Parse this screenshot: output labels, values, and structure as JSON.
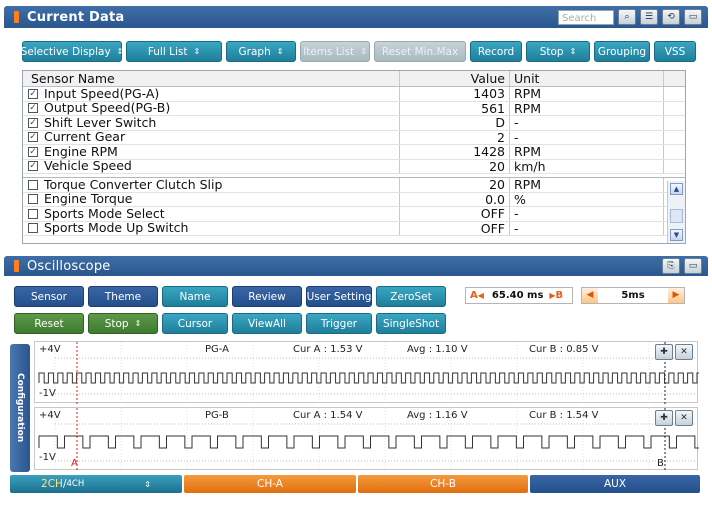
{
  "current_data": {
    "title": "Current Data",
    "search_placeholder": "Search",
    "header_icons": [
      "search-list-icon",
      "list-icon",
      "retrieve-icon",
      "window-icon"
    ],
    "toolbar": [
      {
        "label": "Selective Display",
        "dropdown": true,
        "disabled": false
      },
      {
        "label": "Full List",
        "dropdown": true,
        "disabled": false
      },
      {
        "label": "Graph",
        "dropdown": true,
        "disabled": false
      },
      {
        "label": "Items List",
        "dropdown": true,
        "disabled": true
      },
      {
        "label": "Reset Min.Max",
        "dropdown": false,
        "disabled": true
      },
      {
        "label": "Record",
        "dropdown": false,
        "disabled": false
      },
      {
        "label": "Stop",
        "dropdown": true,
        "disabled": false
      },
      {
        "label": "Grouping",
        "dropdown": false,
        "disabled": false
      },
      {
        "label": "VSS",
        "dropdown": false,
        "disabled": false
      }
    ],
    "table": {
      "headers": {
        "name": "Sensor Name",
        "value": "Value",
        "unit": "Unit"
      },
      "selected_rows": [
        {
          "name": "Input Speed(PG-A)",
          "value": "1403",
          "unit": "RPM"
        },
        {
          "name": "Output Speed(PG-B)",
          "value": "561",
          "unit": "RPM"
        },
        {
          "name": "Shift Lever Switch",
          "value": "D",
          "unit": "-"
        },
        {
          "name": "Current Gear",
          "value": "2",
          "unit": "-"
        },
        {
          "name": "Engine RPM",
          "value": "1428",
          "unit": "RPM"
        },
        {
          "name": "Vehicle Speed",
          "value": "20",
          "unit": "km/h"
        }
      ],
      "other_rows": [
        {
          "name": "Torque Converter Clutch Slip",
          "value": "20",
          "unit": "RPM"
        },
        {
          "name": "Engine Torque",
          "value": "0.0",
          "unit": "%"
        },
        {
          "name": "Sports Mode Select",
          "value": "OFF",
          "unit": "-"
        },
        {
          "name": "Sports Mode Up Switch",
          "value": "OFF",
          "unit": "-"
        }
      ]
    }
  },
  "oscilloscope": {
    "title": "Oscilloscope",
    "row1": [
      {
        "label": "Sensor",
        "style": "navy"
      },
      {
        "label": "Theme",
        "style": "navy"
      },
      {
        "label": "Name",
        "style": "teal"
      },
      {
        "label": "Review",
        "style": "navy"
      },
      {
        "label": "User Setting",
        "style": "navy"
      },
      {
        "label": "ZeroSet",
        "style": "teal"
      }
    ],
    "row2": [
      {
        "label": "Reset",
        "style": "green"
      },
      {
        "label": "Stop",
        "style": "green",
        "dropdown": true
      },
      {
        "label": "Cursor",
        "style": "teal"
      },
      {
        "label": "ViewAll",
        "style": "teal"
      },
      {
        "label": "Trigger",
        "style": "teal"
      },
      {
        "label": "SingleShot",
        "style": "teal"
      }
    ],
    "cursor_delta": {
      "a_marker": "A",
      "value": "65.40 ms",
      "b_marker": "B"
    },
    "time_div": "5ms",
    "config_tab": "Configuration",
    "channels": [
      {
        "name": "PG-A",
        "max": "+4V",
        "min": "-1V",
        "cur_a": "Cur A : 1.53 V",
        "avg": "Avg : 1.10 V",
        "cur_b": "Cur B : 0.85 V"
      },
      {
        "name": "PG-B",
        "max": "+4V",
        "min": "-1V",
        "cur_a": "Cur A : 1.54 V",
        "avg": "Avg : 1.16 V",
        "cur_b": "Cur B : 1.54 V"
      }
    ],
    "cursor_labels": {
      "a": "A",
      "b": "B"
    }
  },
  "bottom_bar": {
    "channel_mode_active": "2CH",
    "channel_mode_sep": "/",
    "channel_mode_alt": "4CH",
    "tabs": [
      "CH-A",
      "CH-B",
      "AUX"
    ]
  },
  "colors": {
    "accent": "#ff7f1e",
    "header": "#2b5690",
    "teal": "#1f7f9c",
    "green": "#3f7a30",
    "cursor": "#e01b1b"
  }
}
